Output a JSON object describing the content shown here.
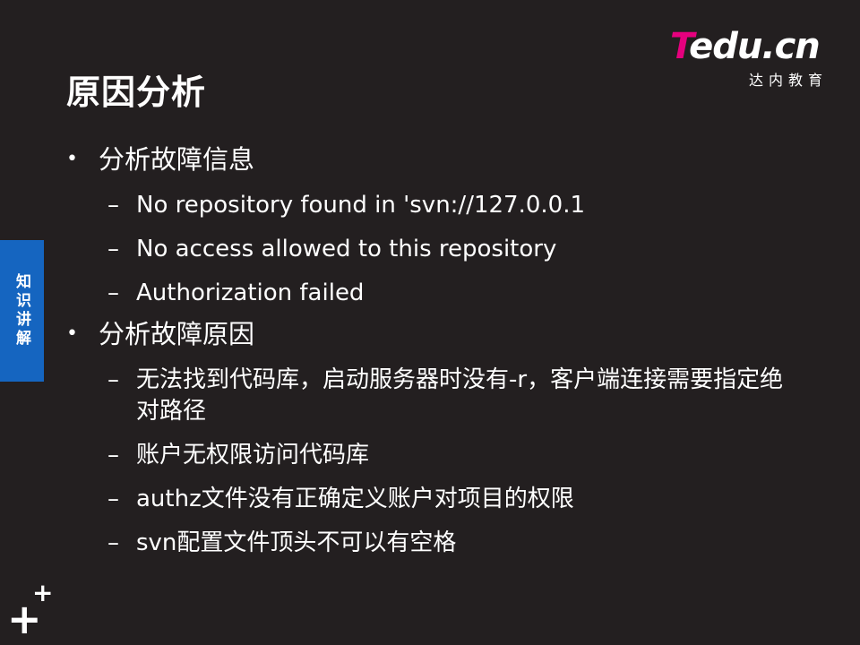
{
  "slide": {
    "title": "原因分析",
    "side_tab": "知识讲解"
  },
  "logo": {
    "t": "T",
    "rest": "edu.cn",
    "subtitle": "达内教育"
  },
  "sections": [
    {
      "heading": "分析故障信息",
      "items": [
        "No repository found in 'svn://127.0.0.1",
        "No access allowed to this repository",
        "Authorization failed"
      ]
    },
    {
      "heading": "分析故障原因",
      "items": [
        "无法找到代码库，启动服务器时没有-r，客户端连接需要指定绝对路径",
        "账户无权限访问代码库",
        "authz文件没有正确定义账户对项目的权限",
        "svn配置文件顶头不可以有空格"
      ]
    }
  ],
  "bullet_dash": "–",
  "icons": {
    "corner": "plus-mark-icon",
    "bullet": "bullet-dot-icon"
  },
  "colors": {
    "background": "#231f20",
    "accent_magenta": "#e6007e",
    "side_tab_blue": "#1565c0"
  }
}
